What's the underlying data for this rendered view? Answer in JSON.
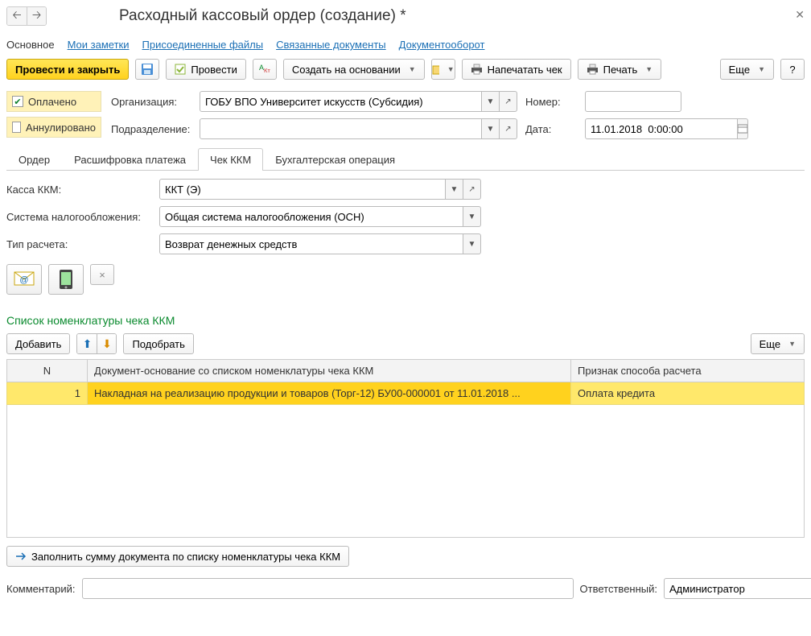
{
  "header": {
    "title": "Расходный кассовый ордер (создание) *"
  },
  "nav": {
    "main": "Основное",
    "notes": "Мои заметки",
    "files": "Присоединенные файлы",
    "linked": "Связанные документы",
    "workflow": "Документооборот"
  },
  "toolbar": {
    "post_close": "Провести и закрыть",
    "post": "Провести",
    "create_based": "Создать на основании",
    "print_check": "Напечатать чек",
    "print": "Печать",
    "more": "Еще"
  },
  "flags": {
    "paid": "Оплачено",
    "void": "Аннулировано"
  },
  "fields": {
    "org_label": "Организация:",
    "org_value": "ГОБУ ВПО Университет искусств (Субсидия)",
    "dept_label": "Подразделение:",
    "dept_value": "",
    "number_label": "Номер:",
    "number_value": "",
    "date_label": "Дата:",
    "date_value": "11.01.2018  0:00:00"
  },
  "subtabs": {
    "order": "Ордер",
    "payment": "Расшифровка платежа",
    "check": "Чек ККМ",
    "accounting": "Бухгалтерская операция"
  },
  "check": {
    "kassa_label": "Касса ККМ:",
    "kassa_value": "ККТ (Э)",
    "tax_label": "Система налогообложения:",
    "tax_value": "Общая система налогообложения (ОСН)",
    "calc_label": "Тип расчета:",
    "calc_value": "Возврат денежных средств"
  },
  "list": {
    "title": "Список номенклатуры чека ККМ",
    "add": "Добавить",
    "pick": "Подобрать",
    "more": "Еще",
    "col_n": "N",
    "col_doc": "Документ-основание со списком номенклатуры чека ККМ",
    "col_sign": "Признак способа расчета",
    "rows": [
      {
        "n": "1",
        "doc": "Накладная на реализацию продукции и товаров (Торг-12) БУ00-000001 от 11.01.2018 ...",
        "sign": "Оплата кредита"
      }
    ],
    "fill_sum": "Заполнить сумму документа по списку номенклатуры чека ККМ"
  },
  "footer": {
    "comment_label": "Комментарий:",
    "comment_value": "",
    "resp_label": "Ответственный:",
    "resp_value": "Администратор"
  }
}
